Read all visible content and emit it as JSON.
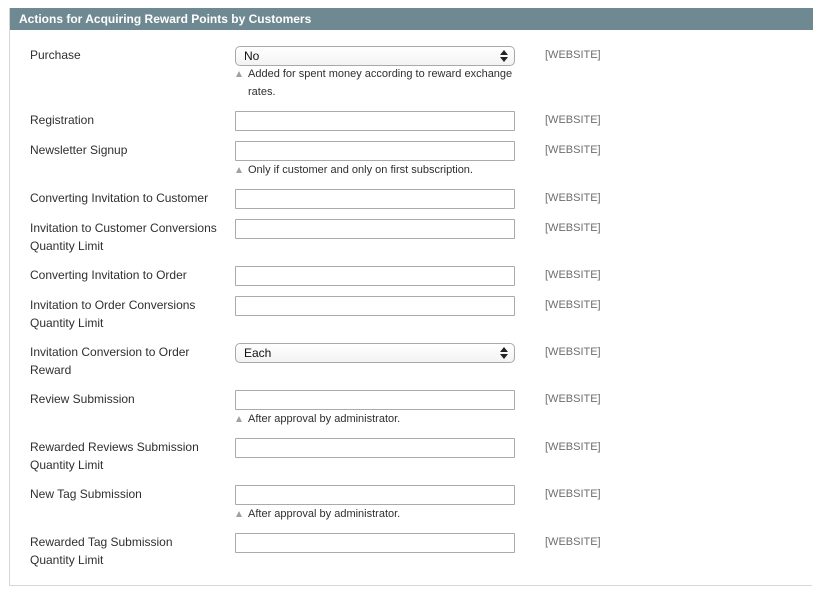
{
  "section": {
    "title": "Actions for Acquiring Reward Points by Customers"
  },
  "rows": [
    {
      "label": "Purchase",
      "type": "select",
      "value": "No",
      "scope": "[WEBSITE]",
      "note": "Added for spent money according to reward exchange rates."
    },
    {
      "label": "Registration",
      "type": "text",
      "value": "",
      "scope": "[WEBSITE]",
      "note": ""
    },
    {
      "label": "Newsletter Signup",
      "type": "text",
      "value": "",
      "scope": "[WEBSITE]",
      "note": "Only if customer and only on first subscription."
    },
    {
      "label": "Converting Invitation to Customer",
      "type": "text",
      "value": "",
      "scope": "[WEBSITE]",
      "note": ""
    },
    {
      "label": "Invitation to Customer Conversions Quantity Limit",
      "type": "text",
      "value": "",
      "scope": "[WEBSITE]",
      "note": ""
    },
    {
      "label": "Converting Invitation to Order",
      "type": "text",
      "value": "",
      "scope": "[WEBSITE]",
      "note": ""
    },
    {
      "label": "Invitation to Order Conversions Quantity Limit",
      "type": "text",
      "value": "",
      "scope": "[WEBSITE]",
      "note": ""
    },
    {
      "label": "Invitation Conversion to Order Reward",
      "type": "select",
      "value": "Each",
      "scope": "[WEBSITE]",
      "note": ""
    },
    {
      "label": "Review Submission",
      "type": "text",
      "value": "",
      "scope": "[WEBSITE]",
      "note": "After approval by administrator."
    },
    {
      "label": "Rewarded Reviews Submission Quantity Limit",
      "type": "text",
      "value": "",
      "scope": "[WEBSITE]",
      "note": ""
    },
    {
      "label": "New Tag Submission",
      "type": "text",
      "value": "",
      "scope": "[WEBSITE]",
      "note": "After approval by administrator."
    },
    {
      "label": "Rewarded Tag Submission Quantity Limit",
      "type": "text",
      "value": "",
      "scope": "[WEBSITE]",
      "note": ""
    }
  ]
}
